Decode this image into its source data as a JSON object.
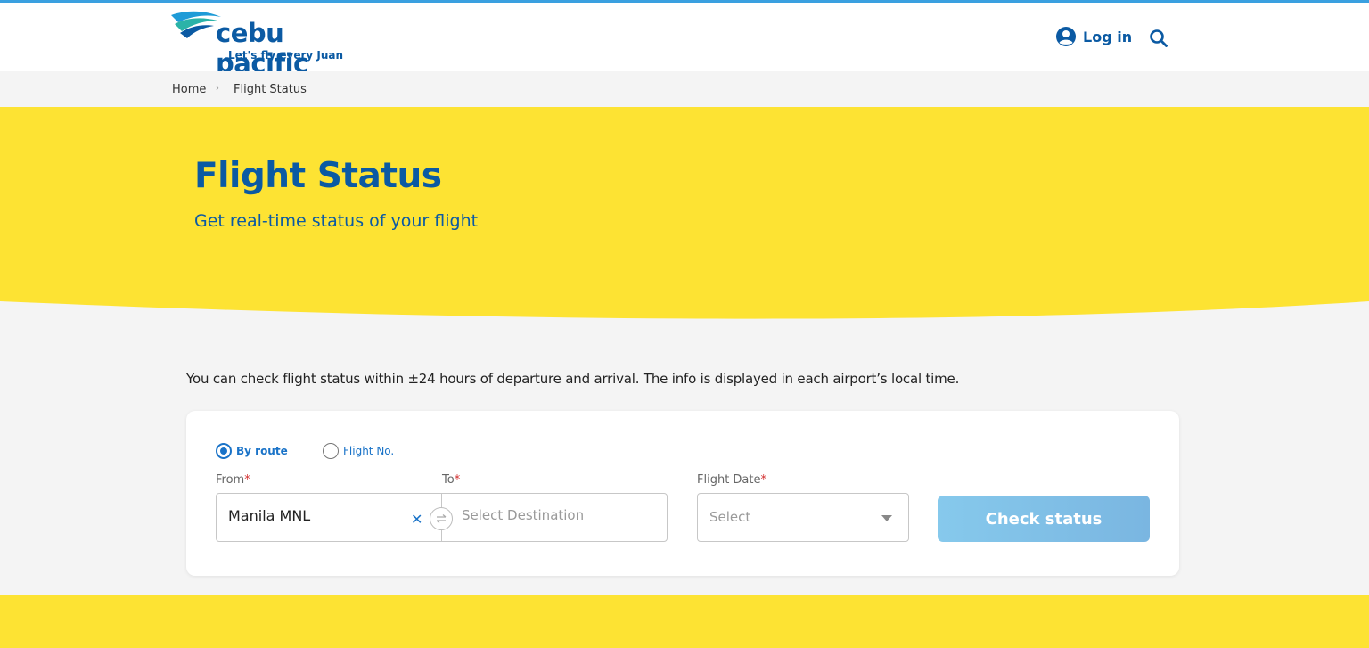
{
  "header": {
    "logo_name": "cebu pacific",
    "logo_tagline": "Let's fly every Juan",
    "login_label": "Log in",
    "icons": {
      "login": "user-circle-icon",
      "search": "search-icon"
    }
  },
  "breadcrumb": {
    "items": [
      "Home",
      "Flight Status"
    ]
  },
  "hero": {
    "title": "Flight Status",
    "subtitle": "Get real-time status of your flight"
  },
  "info_text": "You can check flight status within ±24 hours of departure and arrival. The info is displayed in each airport’s local time.",
  "form": {
    "modes": [
      {
        "label": "By route",
        "selected": true
      },
      {
        "label": "Flight No.",
        "selected": false
      }
    ],
    "from": {
      "label": "From",
      "value": "Manila MNL"
    },
    "to": {
      "label": "To",
      "placeholder": "Select Destination"
    },
    "date": {
      "label": "Flight Date",
      "value": "Select"
    },
    "required_marker": "*",
    "submit_label": "Check status"
  },
  "colors": {
    "brand_blue": "#0b5aa3",
    "accent_yellow": "#fde333",
    "link_blue": "#1a73c8",
    "button_disabled": "#86c9ec"
  }
}
